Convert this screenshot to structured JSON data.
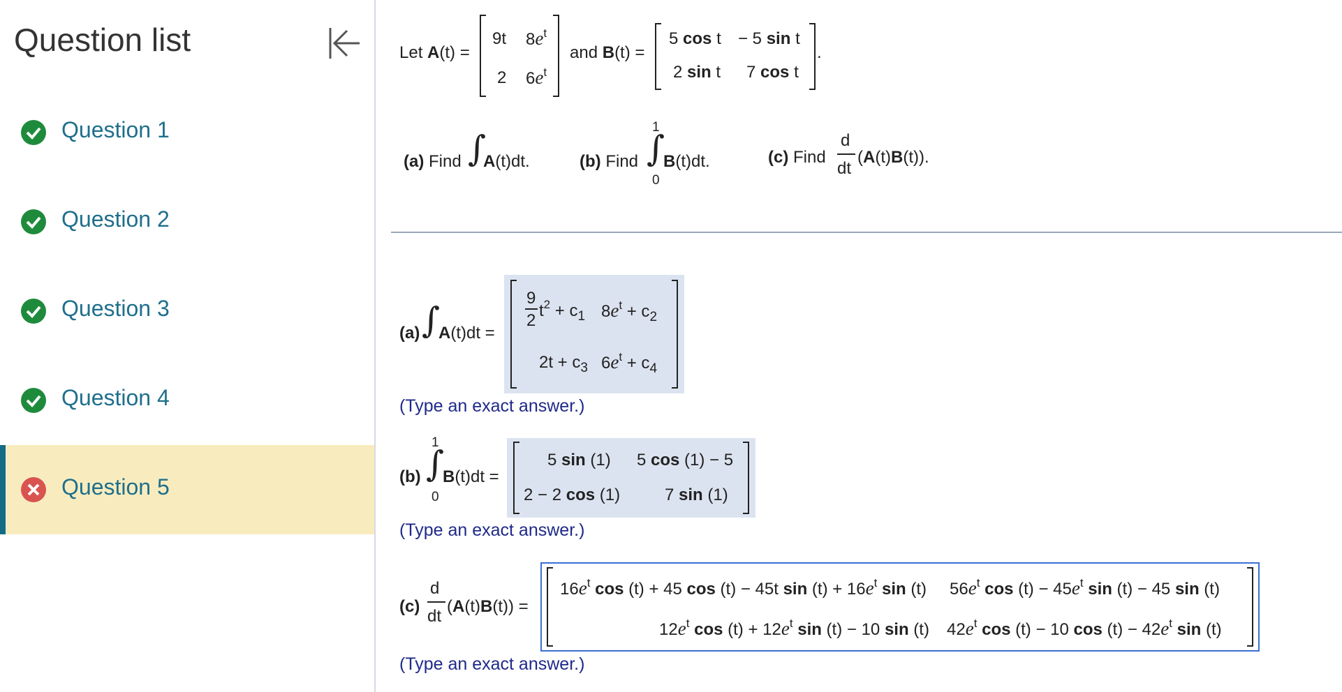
{
  "sidebar": {
    "title": "Question list",
    "collapse_icon": "collapse-left-icon",
    "items": [
      {
        "label": "Question 1",
        "status": "correct",
        "icon": "check-circle-icon"
      },
      {
        "label": "Question 2",
        "status": "correct",
        "icon": "check-circle-icon"
      },
      {
        "label": "Question 3",
        "status": "correct",
        "icon": "check-circle-icon"
      },
      {
        "label": "Question 4",
        "status": "correct",
        "icon": "check-circle-icon"
      },
      {
        "label": "Question 5",
        "status": "incorrect",
        "icon": "x-circle-icon",
        "selected": true
      }
    ]
  },
  "colors": {
    "correct": "#1e8b3c",
    "incorrect": "#d9534f",
    "link": "#1f6f8c",
    "active_bg": "#f8ecbf",
    "active_bar": "#136b86",
    "answer_bg": "#dce3f0",
    "focus_border": "#3b6fd4",
    "hint": "#1f2a8a"
  },
  "problem": {
    "let": "Let ",
    "A_name": "A",
    "t_arg": "(t) =",
    "and": "and ",
    "B_name": "B",
    "period": ".",
    "A": {
      "r1c1": "9t",
      "r1c2_coef": "8",
      "r2c1": "2",
      "r2c2_coef": "6",
      "e": "e",
      "t": "t"
    },
    "B": {
      "r1c1_num": "5",
      "r1c1_fn": "cos",
      "r1c1_t": "t",
      "r1c2_num": "− 5",
      "r1c2_fn": "sin",
      "r1c2_t": "t",
      "r2c1_num": "2",
      "r2c1_fn": "sin",
      "r2c1_t": "t",
      "r2c2_num": "7",
      "r2c2_fn": "cos",
      "r2c2_t": "t"
    },
    "a_label": "(a)",
    "b_label": "(b)",
    "c_label": "(c)",
    "find": " Find",
    "a_body": "(t)dt.",
    "b_body": "(t)dt.",
    "lower": "0",
    "upper": "1",
    "d": "d",
    "dt": "dt",
    "c_open": "(",
    "c_close": "(t)).",
    "c_mid": "(t)"
  },
  "answers": {
    "hint": "(Type an exact answer.)",
    "a": {
      "label": "(a)",
      "rhs": "(t)dt =",
      "r1c1_num": "9",
      "r1c1_den": "2",
      "r1c1_t": "t",
      "r1c1_exp": "2",
      "r1c1_plus": " + c",
      "r1c1_sub": "1",
      "r1c2_coef": "8",
      "r1c2_e": "e",
      "r1c2_exp": "t",
      "r1c2_plus": " + c",
      "r1c2_sub": "2",
      "r2c1": "2t + c",
      "r2c1_sub": "3",
      "r2c2_coef": "6",
      "r2c2_e": "e",
      "r2c2_exp": "t",
      "r2c2_plus": " + c",
      "r2c2_sub": "4"
    },
    "b": {
      "label": "(b)",
      "rhs": "(t)dt =",
      "r1c1_a": "5 ",
      "r1c1_fn": "sin",
      "r1c1_b": " (1)",
      "r1c2_a": "5 ",
      "r1c2_fn": "cos",
      "r1c2_b": " (1) − 5",
      "r2c1_a": "2 − 2 ",
      "r2c1_fn": "cos",
      "r2c1_b": " (1)",
      "r2c2_a": "7 ",
      "r2c2_fn": "sin",
      "r2c2_b": " (1)"
    },
    "c": {
      "label": "(c)",
      "rhs": "(t)) =",
      "r1c1": {
        "p1": "16",
        "p2": " cos",
        "p3": " (t) + 45 ",
        "p4": "cos",
        "p5": " (t) − 45t ",
        "p6": "sin",
        "p7": " (t) + 16",
        "p8": " sin",
        "p9": " (t)"
      },
      "r1c2": {
        "p1": "56",
        "p2": " cos",
        "p3": " (t) − 45",
        "p4": " sin",
        "p5": " (t) − 45 ",
        "p6": "sin",
        "p7": " (t)"
      },
      "r2c1": {
        "p1": "12",
        "p2": " cos",
        "p3": " (t) + 12",
        "p4": " sin",
        "p5": " (t) − 10 ",
        "p6": "sin",
        "p7": " (t)"
      },
      "r2c2": {
        "p1": "42",
        "p2": " cos",
        "p3": " (t) − 10 ",
        "p4": "cos",
        "p5": " (t) − 42",
        "p6": " sin",
        "p7": " (t)"
      },
      "e": "e",
      "t": "t"
    }
  }
}
